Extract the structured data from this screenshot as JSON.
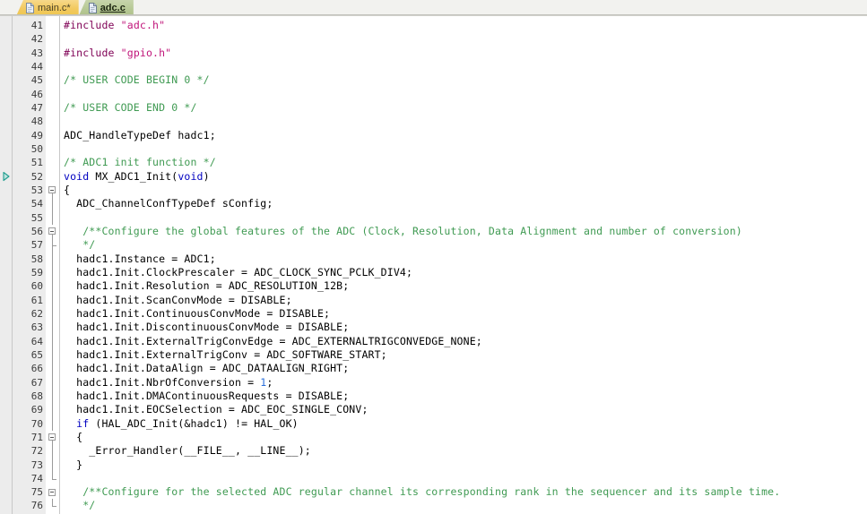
{
  "tabs": [
    {
      "label": "main.c*",
      "icon": "file-icon",
      "active": false,
      "state": "modified"
    },
    {
      "label": "adc.c",
      "icon": "file-icon",
      "active": true,
      "state": "saved"
    }
  ],
  "editor": {
    "first_line_number": 41,
    "marker_line": 52,
    "marker_icon": "run-to-line-arrow-icon",
    "fold_markers": [
      {
        "line": 53,
        "type": "open"
      },
      {
        "line": 56,
        "type": "open"
      },
      {
        "line": 57,
        "type": "end"
      },
      {
        "line": 71,
        "type": "open"
      },
      {
        "line": 74,
        "type": "end"
      },
      {
        "line": 75,
        "type": "open"
      },
      {
        "line": 76,
        "type": "end"
      }
    ],
    "fold_spans": [
      {
        "from": 53,
        "to": 73
      }
    ],
    "bottom_watermark": "",
    "lines": [
      {
        "n": 41,
        "tokens": [
          {
            "t": "#include ",
            "c": "pp"
          },
          {
            "t": "\"adc.h\"",
            "c": "str"
          }
        ]
      },
      {
        "n": 42,
        "tokens": []
      },
      {
        "n": 43,
        "tokens": [
          {
            "t": "#include ",
            "c": "pp"
          },
          {
            "t": "\"gpio.h\"",
            "c": "str"
          }
        ]
      },
      {
        "n": 44,
        "tokens": []
      },
      {
        "n": 45,
        "tokens": [
          {
            "t": "/* USER CODE BEGIN 0 */",
            "c": "cmt"
          }
        ]
      },
      {
        "n": 46,
        "tokens": []
      },
      {
        "n": 47,
        "tokens": [
          {
            "t": "/* USER CODE END 0 */",
            "c": "cmt"
          }
        ]
      },
      {
        "n": 48,
        "tokens": []
      },
      {
        "n": 49,
        "tokens": [
          {
            "t": "ADC_HandleTypeDef hadc1;",
            "c": "plain"
          }
        ]
      },
      {
        "n": 50,
        "tokens": []
      },
      {
        "n": 51,
        "tokens": [
          {
            "t": "/* ADC1 init function */",
            "c": "cmt"
          }
        ]
      },
      {
        "n": 52,
        "tokens": [
          {
            "t": "void",
            "c": "kw"
          },
          {
            "t": " MX_ADC1_Init(",
            "c": "plain"
          },
          {
            "t": "void",
            "c": "kw"
          },
          {
            "t": ")",
            "c": "plain"
          }
        ]
      },
      {
        "n": 53,
        "tokens": [
          {
            "t": "{",
            "c": "plain"
          }
        ]
      },
      {
        "n": 54,
        "tokens": [
          {
            "t": "  ADC_ChannelConfTypeDef sConfig;",
            "c": "plain"
          }
        ]
      },
      {
        "n": 55,
        "tokens": []
      },
      {
        "n": 56,
        "tokens": [
          {
            "t": "   /**Configure the global features of the ADC (Clock, Resolution, Data Alignment and number of conversion)",
            "c": "cmt"
          }
        ]
      },
      {
        "n": 57,
        "tokens": [
          {
            "t": "   */",
            "c": "cmt"
          }
        ]
      },
      {
        "n": 58,
        "tokens": [
          {
            "t": "  hadc1.Instance = ADC1;",
            "c": "plain"
          }
        ]
      },
      {
        "n": 59,
        "tokens": [
          {
            "t": "  hadc1.Init.ClockPrescaler = ADC_CLOCK_SYNC_PCLK_DIV4;",
            "c": "plain"
          }
        ]
      },
      {
        "n": 60,
        "tokens": [
          {
            "t": "  hadc1.Init.Resolution = ADC_RESOLUTION_12B;",
            "c": "plain"
          }
        ]
      },
      {
        "n": 61,
        "tokens": [
          {
            "t": "  hadc1.Init.ScanConvMode = DISABLE;",
            "c": "plain"
          }
        ]
      },
      {
        "n": 62,
        "tokens": [
          {
            "t": "  hadc1.Init.ContinuousConvMode = DISABLE;",
            "c": "plain"
          }
        ]
      },
      {
        "n": 63,
        "tokens": [
          {
            "t": "  hadc1.Init.DiscontinuousConvMode = DISABLE;",
            "c": "plain"
          }
        ]
      },
      {
        "n": 64,
        "tokens": [
          {
            "t": "  hadc1.Init.ExternalTrigConvEdge = ADC_EXTERNALTRIGCONVEDGE_NONE;",
            "c": "plain"
          }
        ]
      },
      {
        "n": 65,
        "tokens": [
          {
            "t": "  hadc1.Init.ExternalTrigConv = ADC_SOFTWARE_START;",
            "c": "plain"
          }
        ]
      },
      {
        "n": 66,
        "tokens": [
          {
            "t": "  hadc1.Init.DataAlign = ADC_DATAALIGN_RIGHT;",
            "c": "plain"
          }
        ]
      },
      {
        "n": 67,
        "tokens": [
          {
            "t": "  hadc1.Init.NbrOfConversion = ",
            "c": "plain"
          },
          {
            "t": "1",
            "c": "num"
          },
          {
            "t": ";",
            "c": "plain"
          }
        ]
      },
      {
        "n": 68,
        "tokens": [
          {
            "t": "  hadc1.Init.DMAContinuousRequests = DISABLE;",
            "c": "plain"
          }
        ]
      },
      {
        "n": 69,
        "tokens": [
          {
            "t": "  hadc1.Init.EOCSelection = ADC_EOC_SINGLE_CONV;",
            "c": "plain"
          }
        ]
      },
      {
        "n": 70,
        "tokens": [
          {
            "t": "  ",
            "c": "plain"
          },
          {
            "t": "if",
            "c": "kw"
          },
          {
            "t": " (HAL_ADC_Init(&hadc1) != HAL_OK)",
            "c": "plain"
          }
        ]
      },
      {
        "n": 71,
        "tokens": [
          {
            "t": "  {",
            "c": "plain"
          }
        ]
      },
      {
        "n": 72,
        "tokens": [
          {
            "t": "    _Error_Handler(__FILE__, __LINE__);",
            "c": "plain"
          }
        ]
      },
      {
        "n": 73,
        "tokens": [
          {
            "t": "  }",
            "c": "plain"
          }
        ]
      },
      {
        "n": 74,
        "tokens": []
      },
      {
        "n": 75,
        "tokens": [
          {
            "t": "   /**Configure for the selected ADC regular channel its corresponding rank in the sequencer and its sample time.",
            "c": "cmt"
          }
        ]
      },
      {
        "n": 76,
        "tokens": [
          {
            "t": "   */",
            "c": "cmt"
          }
        ]
      }
    ]
  },
  "colors": {
    "tab_active_bg": "#b6c894",
    "tab_inactive_bg": "#f2c95f",
    "gutter_bg": "#ececec",
    "editor_bg": "#ffffff",
    "comment": "#3f9a52",
    "keyword": "#0000c0",
    "string": "#c0157a",
    "preprocessor": "#7f0055",
    "number": "#2a6fdb",
    "marker": "#1f9d8e"
  }
}
